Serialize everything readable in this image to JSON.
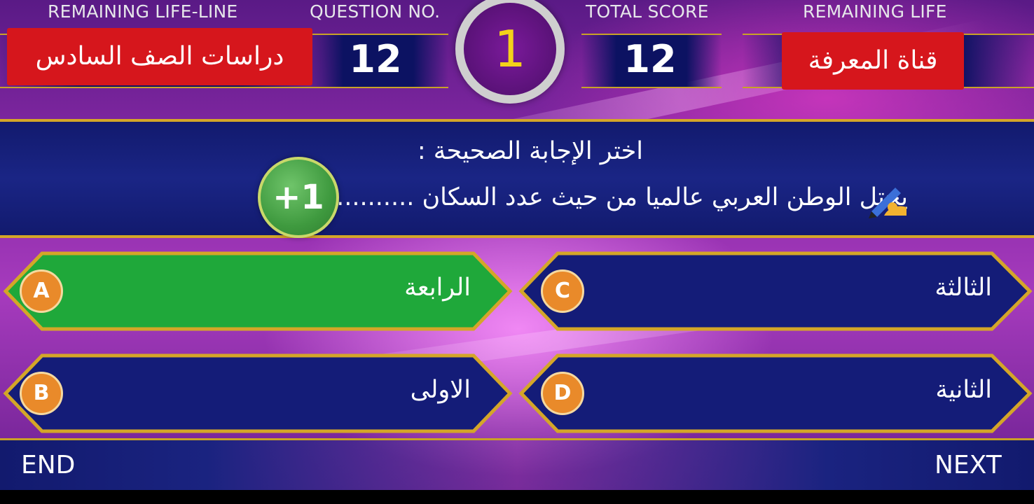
{
  "hud": {
    "remaining_lifeline_label": "REMAINING LIFE-LINE",
    "question_no_label": "QUESTION NO.",
    "total_score_label": "TOTAL SCORE",
    "remaining_life_label": "REMAINING LIFE",
    "question_no": "12",
    "total_score": "12",
    "timer": "1"
  },
  "tags": {
    "left": "دراسات الصف السادس",
    "right": "قناة المعرفة"
  },
  "question": {
    "instruction": "اختر الإجابة الصحيحة :",
    "text": "يحتل الوطن العربي عالميا من حيث عدد السكان ..............",
    "badge": "+1"
  },
  "answers": {
    "a": {
      "letter": "A",
      "text": "الرابعة",
      "state": "correct"
    },
    "b": {
      "letter": "B",
      "text": "الاولى"
    },
    "c": {
      "letter": "C",
      "text": "الثالثة"
    },
    "d": {
      "letter": "D",
      "text": "الثانية"
    }
  },
  "nav": {
    "end": "END",
    "next": "NEXT"
  },
  "colors": {
    "panel_blue": "#141c78",
    "gold_border": "#d4a628",
    "correct_green": "#1fa83a",
    "letter_orange": "#e98a2a",
    "tag_red": "#d6161c",
    "timer_digit": "#f3d21a"
  },
  "icons": {
    "question_pen": "writing-hand-icon"
  }
}
